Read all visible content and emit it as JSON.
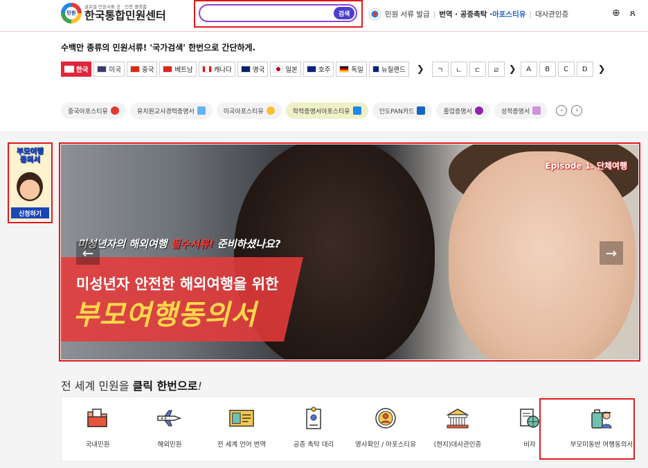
{
  "header": {
    "logo_badge": "민원",
    "logo_sub": "글로벌 민원서류 공 · 인증 플랫폼",
    "logo_main": "한국통합민원센터",
    "search": {
      "placeholder": "",
      "button": "검색"
    },
    "menu": [
      {
        "label": "민원 서류 발급"
      },
      {
        "label": "번역 · 공증촉탁 · ",
        "strong": true
      },
      {
        "label": "아포스티유",
        "accent": true
      },
      {
        "label": "대사관인증"
      }
    ],
    "icons": [
      "globe-icon",
      "user-icon"
    ]
  },
  "tagline": "수백만 종류의 민원서류! '국가검색' 한번으로 간단하게.",
  "countries": [
    {
      "label": "한국",
      "active": true,
      "flag": "#cd2e3a"
    },
    {
      "label": "미국",
      "flag": "#3c3b6e"
    },
    {
      "label": "중국",
      "flag": "#de2910"
    },
    {
      "label": "베트남",
      "flag": "#da251d"
    },
    {
      "label": "캐나다",
      "flag": "#ff0000"
    },
    {
      "label": "영국",
      "flag": "#012169"
    },
    {
      "label": "일본",
      "flag": "#ffffff"
    },
    {
      "label": "호주",
      "flag": "#00247d"
    },
    {
      "label": "독일",
      "flag": "#000000"
    },
    {
      "label": "뉴질랜드",
      "flag": "#00247d"
    }
  ],
  "alphabet": [
    "ㄱ",
    "ㄴ",
    "ㄷ",
    "ㄹ",
    "A",
    "B",
    "C",
    "D"
  ],
  "doc_chips": [
    {
      "label": "중국아포스티유",
      "color": "#e53935"
    },
    {
      "label": "유치원교사경력증명서",
      "color": "#64b5f6"
    },
    {
      "label": "미국아포스티유",
      "color": "#fbc02d"
    },
    {
      "label": "학력증명서아포스티유",
      "color": "#1e88e5",
      "highlight": true
    },
    {
      "label": "인도PAN카드",
      "color": "#1565c0"
    },
    {
      "label": "졸업증명서",
      "color": "#8e24aa"
    },
    {
      "label": "성적증명서",
      "color": "#ce93d8"
    }
  ],
  "side_banner": {
    "title": "부모여행\n동의서",
    "button": "신청하기"
  },
  "banner": {
    "episode": "Episode 1. 단체여행",
    "line1_a": "미성년자의 해외여행 ",
    "line1_b": "필수서류!",
    "line1_c": " 준비하셨나요?",
    "line2": "미성년자 안전한 해외여행을 위한",
    "line3": "부모여행동의서",
    "prev": "←",
    "next": "→"
  },
  "services_title_a": "전 세계 민원을 ",
  "services_title_b": "클릭 한번으로",
  "services_title_c": "!",
  "services": [
    {
      "label": "국내민원",
      "icon": "folder-icon"
    },
    {
      "label": "해외민원",
      "icon": "airplane-icon"
    },
    {
      "label": "전 세계 언어 번역",
      "icon": "passport-icon"
    },
    {
      "label": "공증 촉탁 대리",
      "icon": "notary-document-icon"
    },
    {
      "label": "영사확인 / 아포스티유",
      "icon": "seal-icon"
    },
    {
      "label": "(현지)대사관인증",
      "icon": "embassy-icon"
    },
    {
      "label": "비자",
      "icon": "visa-icon"
    },
    {
      "label": "부모미동반 여행동의서",
      "icon": "traveler-icon"
    }
  ],
  "colors": {
    "brand_red": "#e0263a",
    "brand_blue": "#1b46b8",
    "search_purple": "#8a43d6",
    "search_button": "#4a3ecf",
    "highlight_box": "#e01818"
  }
}
